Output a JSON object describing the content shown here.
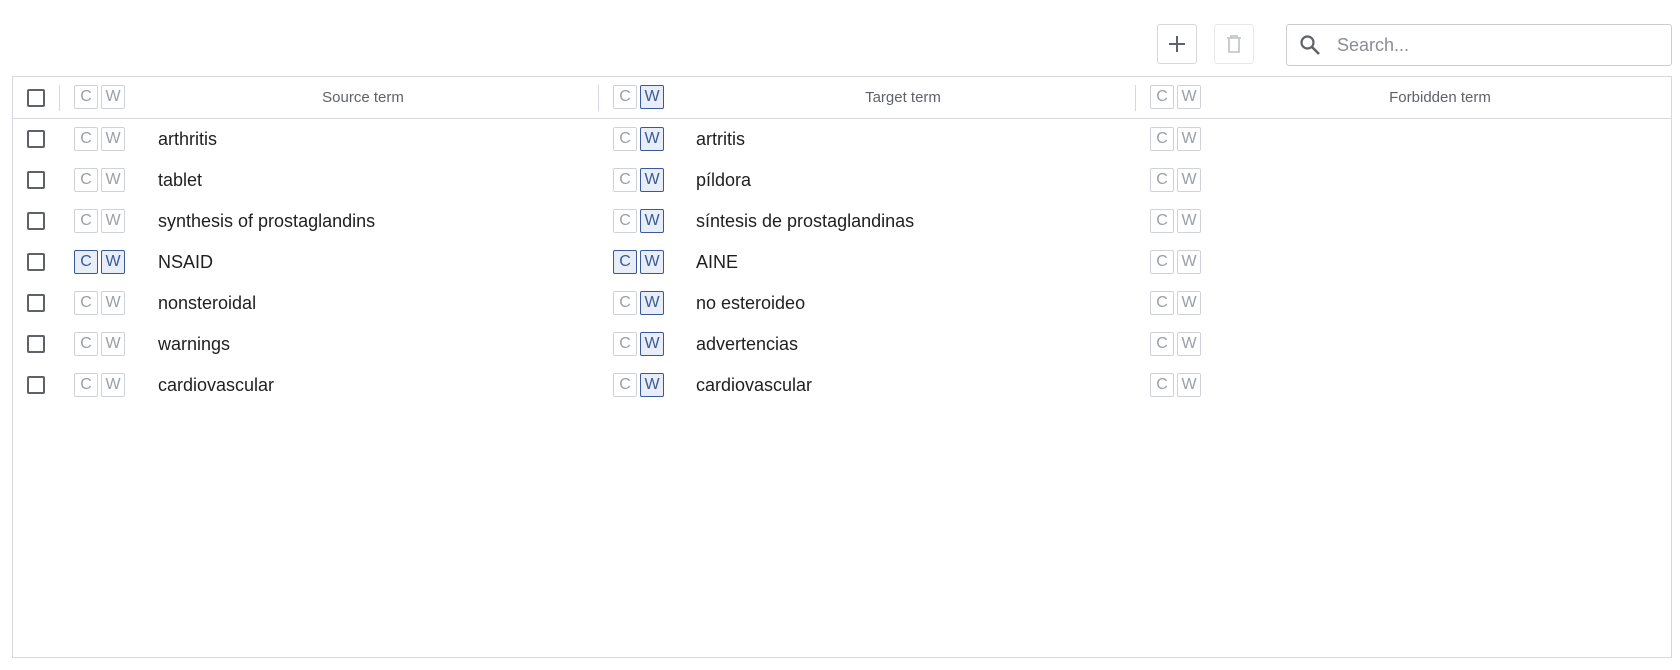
{
  "toolbar": {
    "add_icon": "plus-icon",
    "delete_icon": "trash-icon",
    "search_icon": "search-icon",
    "search_placeholder": "Search...",
    "search_value": ""
  },
  "columns": {
    "source": "Source term",
    "target": "Target term",
    "forbidden": "Forbidden term"
  },
  "toggle_labels": {
    "c": "C",
    "w": "W"
  },
  "header_toggles": {
    "source": {
      "c": false,
      "w": false
    },
    "target": {
      "c": false,
      "w": true
    },
    "forbidden": {
      "c": false,
      "w": false
    }
  },
  "rows": [
    {
      "checked": false,
      "source": "arthritis",
      "source_c": false,
      "source_w": false,
      "target": "artritis",
      "target_c": false,
      "target_w": true,
      "forbidden": "",
      "forbidden_c": false,
      "forbidden_w": false
    },
    {
      "checked": false,
      "source": "tablet",
      "source_c": false,
      "source_w": false,
      "target": "píldora",
      "target_c": false,
      "target_w": true,
      "forbidden": "",
      "forbidden_c": false,
      "forbidden_w": false
    },
    {
      "checked": false,
      "source": "synthesis of prostaglandins",
      "source_c": false,
      "source_w": false,
      "target": "síntesis de prostaglandinas",
      "target_c": false,
      "target_w": true,
      "forbidden": "",
      "forbidden_c": false,
      "forbidden_w": false
    },
    {
      "checked": false,
      "source": "NSAID",
      "source_c": true,
      "source_w": true,
      "target": "AINE",
      "target_c": true,
      "target_w": true,
      "forbidden": "",
      "forbidden_c": false,
      "forbidden_w": false
    },
    {
      "checked": false,
      "source": "nonsteroidal",
      "source_c": false,
      "source_w": false,
      "target": "no esteroideo",
      "target_c": false,
      "target_w": true,
      "forbidden": "",
      "forbidden_c": false,
      "forbidden_w": false
    },
    {
      "checked": false,
      "source": "warnings",
      "source_c": false,
      "source_w": false,
      "target": "advertencias",
      "target_c": false,
      "target_w": true,
      "forbidden": "",
      "forbidden_c": false,
      "forbidden_w": false
    },
    {
      "checked": false,
      "source": "cardiovascular",
      "source_c": false,
      "source_w": false,
      "target": "cardiovascular",
      "target_c": false,
      "target_w": true,
      "forbidden": "",
      "forbidden_c": false,
      "forbidden_w": false
    }
  ],
  "colors": {
    "toggle_active_border": "#3b5998",
    "toggle_active_bg": "#e8eef8",
    "toggle_inactive": "#9aa0a6",
    "border": "#d5d8dc"
  }
}
